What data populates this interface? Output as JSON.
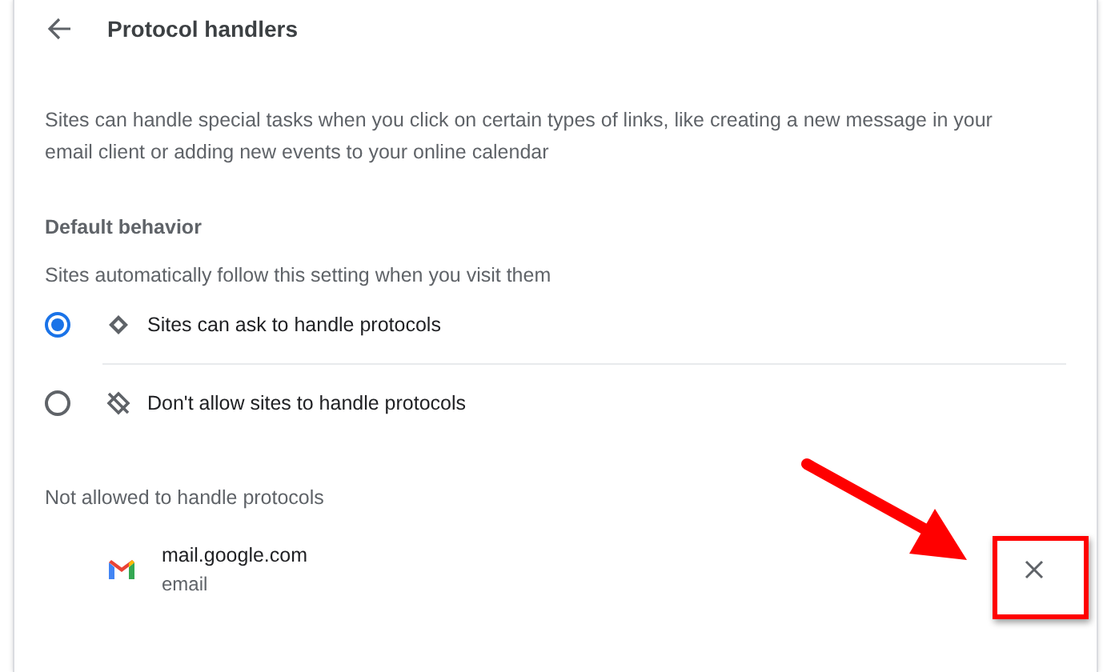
{
  "header": {
    "title": "Protocol handlers"
  },
  "description": "Sites can handle special tasks when you click on certain types of links, like creating a new message in your email client or adding new events to your online calendar",
  "default_behavior": {
    "heading": "Default behavior",
    "subtitle": "Sites automatically follow this setting when you visit them",
    "options": [
      {
        "kind": "allow",
        "label": "Sites can ask to handle protocols",
        "selected": true
      },
      {
        "kind": "block",
        "label": "Don't allow sites to handle protocols",
        "selected": false
      }
    ]
  },
  "blocked": {
    "heading": "Not allowed to handle protocols",
    "sites": [
      {
        "name": "mail.google.com",
        "protocol": "email"
      }
    ]
  }
}
